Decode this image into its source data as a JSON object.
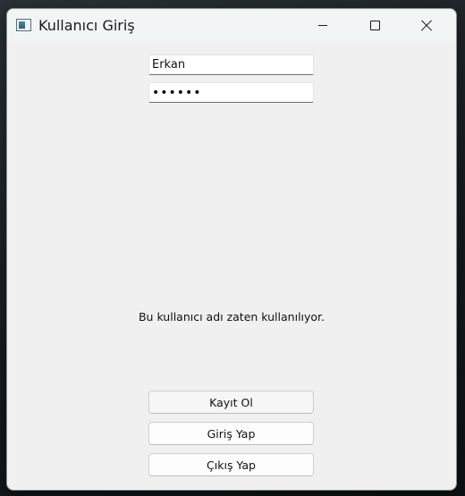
{
  "window": {
    "title": "Kullanıcı Giriş",
    "icon": "app-window-icon"
  },
  "form": {
    "username_value": "Erkan",
    "password_value": "erkan1"
  },
  "status_message": "Bu kullanıcı adı zaten kullanılıyor.",
  "buttons": {
    "register_label": "Kayıt Ol",
    "login_label": "Giriş Yap",
    "exit_label": "Çıkış Yap"
  }
}
